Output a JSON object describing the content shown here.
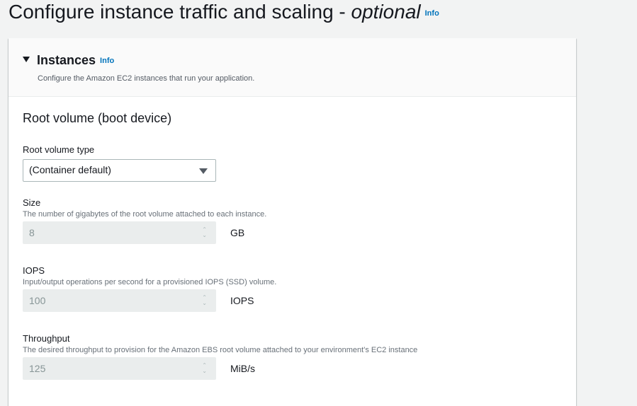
{
  "page": {
    "title": "Configure instance traffic and scaling - ",
    "title_optional": "optional",
    "info": "Info"
  },
  "instances": {
    "title": "Instances",
    "info": "Info",
    "description": "Configure the Amazon EC2 instances that run your application.",
    "section_title": "Root volume (boot device)",
    "root_volume_type": {
      "label": "Root volume type",
      "value": "(Container default)"
    },
    "size": {
      "label": "Size",
      "hint": "The number of gigabytes of the root volume attached to each instance.",
      "value": "8",
      "unit": "GB"
    },
    "iops": {
      "label": "IOPS",
      "hint": "Input/output operations per second for a provisioned IOPS (SSD) volume.",
      "value": "100",
      "unit": "IOPS"
    },
    "throughput": {
      "label": "Throughput",
      "hint": "The desired throughput to provision for the Amazon EBS root volume attached to your environment's EC2 instance",
      "value": "125",
      "unit": "MiB/s"
    }
  }
}
